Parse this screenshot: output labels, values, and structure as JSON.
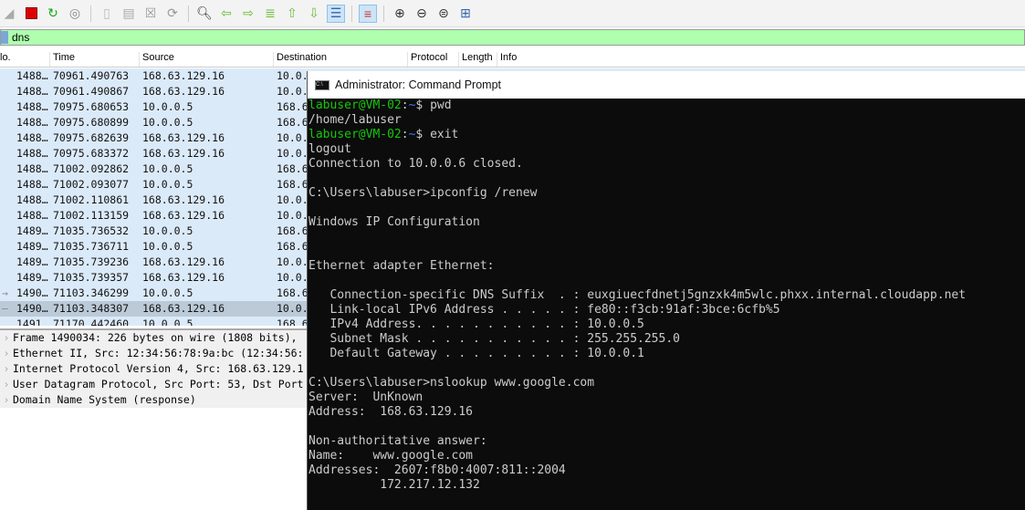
{
  "toolbar": {
    "icons": [
      "shark-fin-icon",
      "stop-icon",
      "restart-icon",
      "options-icon",
      "open-icon",
      "save-icon",
      "close-icon",
      "reload-icon",
      "find-icon",
      "back-icon",
      "forward-icon",
      "goto-icon",
      "first-icon",
      "last-icon",
      "autoscroll-icon",
      "colorize-icon",
      "zoom-in-icon",
      "zoom-out-icon",
      "zoom-reset-icon",
      "resize-columns-icon"
    ]
  },
  "filter": {
    "value": "dns"
  },
  "columns": [
    "lo.",
    "Time",
    "Source",
    "Destination",
    "Protocol",
    "Length",
    "Info"
  ],
  "packets": [
    {
      "no": "1488…",
      "time": "70961.490763",
      "src": "168.63.129.16",
      "dst": "10.0."
    },
    {
      "no": "1488…",
      "time": "70961.490867",
      "src": "168.63.129.16",
      "dst": "10.0."
    },
    {
      "no": "1488…",
      "time": "70975.680653",
      "src": "10.0.0.5",
      "dst": "168.6"
    },
    {
      "no": "1488…",
      "time": "70975.680899",
      "src": "10.0.0.5",
      "dst": "168.6"
    },
    {
      "no": "1488…",
      "time": "70975.682639",
      "src": "168.63.129.16",
      "dst": "10.0."
    },
    {
      "no": "1488…",
      "time": "70975.683372",
      "src": "168.63.129.16",
      "dst": "10.0."
    },
    {
      "no": "1488…",
      "time": "71002.092862",
      "src": "10.0.0.5",
      "dst": "168.6"
    },
    {
      "no": "1488…",
      "time": "71002.093077",
      "src": "10.0.0.5",
      "dst": "168.6"
    },
    {
      "no": "1488…",
      "time": "71002.110861",
      "src": "168.63.129.16",
      "dst": "10.0."
    },
    {
      "no": "1488…",
      "time": "71002.113159",
      "src": "168.63.129.16",
      "dst": "10.0."
    },
    {
      "no": "1489…",
      "time": "71035.736532",
      "src": "10.0.0.5",
      "dst": "168.6"
    },
    {
      "no": "1489…",
      "time": "71035.736711",
      "src": "10.0.0.5",
      "dst": "168.6"
    },
    {
      "no": "1489…",
      "time": "71035.739236",
      "src": "168.63.129.16",
      "dst": "10.0."
    },
    {
      "no": "1489…",
      "time": "71035.739357",
      "src": "168.63.129.16",
      "dst": "10.0."
    },
    {
      "no": "1490…",
      "time": "71103.346299",
      "src": "10.0.0.5",
      "dst": "168.6",
      "mark": "→"
    },
    {
      "no": "1490…",
      "time": "71103.348307",
      "src": "168.63.129.16",
      "dst": "10.0.",
      "mark": "—",
      "selected": true
    },
    {
      "no": "1491…",
      "time": "71170.442460",
      "src": "10.0.0.5",
      "dst": "168.6"
    }
  ],
  "details": [
    "Frame 1490034: 226 bytes on wire (1808 bits),",
    "Ethernet II, Src: 12:34:56:78:9a:bc (12:34:56:",
    "Internet Protocol Version 4, Src: 168.63.129.1",
    "User Datagram Protocol, Src Port: 53, Dst Port",
    "Domain Name System (response)"
  ],
  "cmd": {
    "title": "Administrator: Command Prompt",
    "icon_text": "C:\\",
    "prompt_user": "labuser@VM-02",
    "prompt_sep": ":",
    "prompt_path": "~",
    "prompt_dollar": "$ ",
    "lines": [
      {
        "prompt": true,
        "text": "pwd"
      },
      {
        "text": "/home/labuser"
      },
      {
        "prompt": true,
        "text": "exit"
      },
      {
        "text": "logout"
      },
      {
        "text": "Connection to 10.0.0.6 closed."
      },
      {
        "text": ""
      },
      {
        "text": "C:\\Users\\labuser>ipconfig /renew"
      },
      {
        "text": ""
      },
      {
        "text": "Windows IP Configuration"
      },
      {
        "text": ""
      },
      {
        "text": ""
      },
      {
        "text": "Ethernet adapter Ethernet:"
      },
      {
        "text": ""
      },
      {
        "text": "   Connection-specific DNS Suffix  . : euxgiuecfdnetj5gnzxk4m5wlc.phxx.internal.cloudapp.net"
      },
      {
        "text": "   Link-local IPv6 Address . . . . . : fe80::f3cb:91af:3bce:6cfb%5"
      },
      {
        "text": "   IPv4 Address. . . . . . . . . . . : 10.0.0.5"
      },
      {
        "text": "   Subnet Mask . . . . . . . . . . . : 255.255.255.0"
      },
      {
        "text": "   Default Gateway . . . . . . . . . : 10.0.0.1"
      },
      {
        "text": ""
      },
      {
        "text": "C:\\Users\\labuser>nslookup www.google.com"
      },
      {
        "text": "Server:  UnKnown"
      },
      {
        "text": "Address:  168.63.129.16"
      },
      {
        "text": ""
      },
      {
        "text": "Non-authoritative answer:"
      },
      {
        "text": "Name:    www.google.com"
      },
      {
        "text": "Addresses:  2607:f8b0:4007:811::2004"
      },
      {
        "text": "          172.217.12.132"
      }
    ]
  }
}
